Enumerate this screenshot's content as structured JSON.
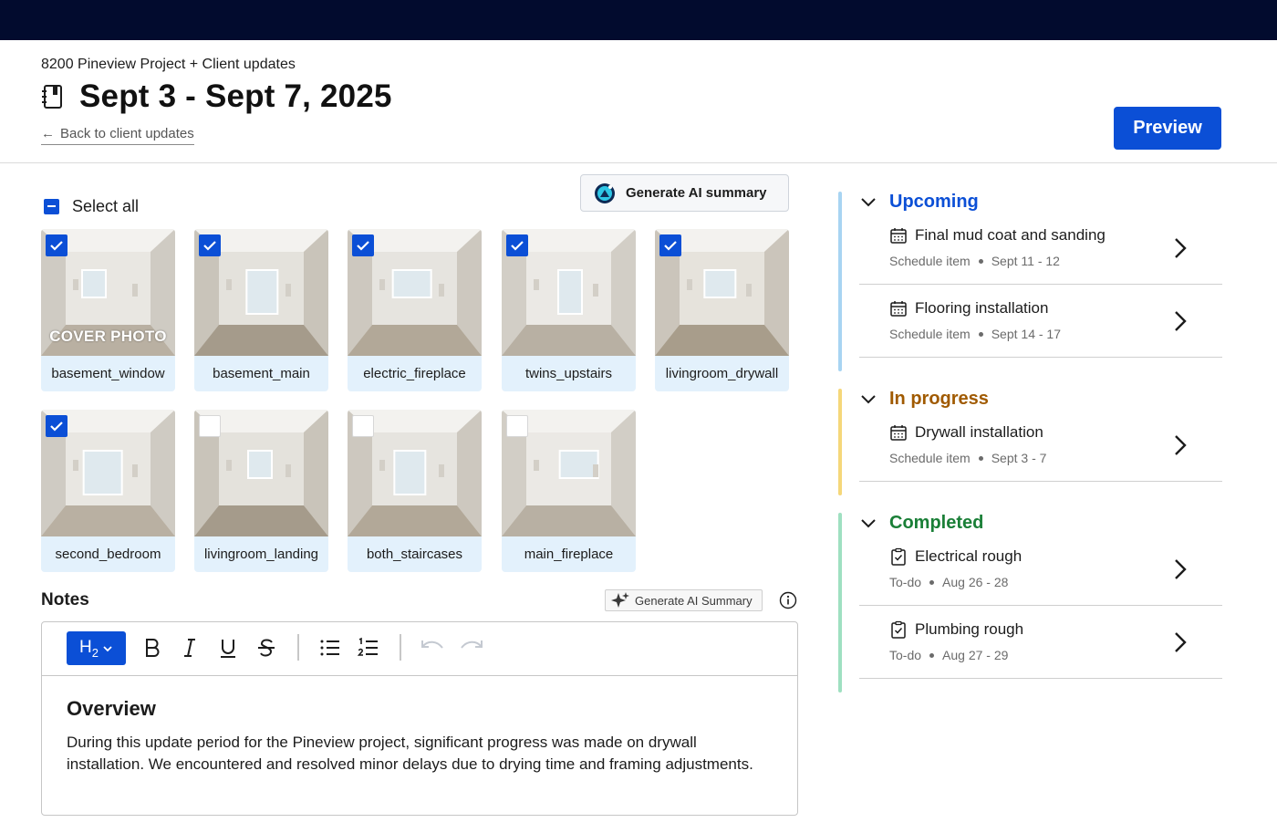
{
  "header": {
    "project_title": "8200 Pineview Project + Client updates",
    "page_title": "Sept 3 - Sept 7, 2025",
    "back_link": "Back to client updates",
    "preview_label": "Preview"
  },
  "gallery": {
    "select_all_label": "Select all",
    "generate_ai_label": "Generate AI summary",
    "cover_label": "COVER PHOTO",
    "photos": [
      {
        "name": "basement_window",
        "checked": true,
        "cover": true
      },
      {
        "name": "basement_main",
        "checked": true
      },
      {
        "name": "electric_fireplace",
        "checked": true
      },
      {
        "name": "twins_upstairs",
        "checked": true
      },
      {
        "name": "livingroom_drywall",
        "checked": true
      },
      {
        "name": "second_bedroom",
        "checked": true
      },
      {
        "name": "livingroom_landing",
        "checked": false
      },
      {
        "name": "both_staircases",
        "checked": false
      },
      {
        "name": "main_fireplace",
        "checked": false
      }
    ]
  },
  "notes": {
    "label": "Notes",
    "generate_ai_label": "Generate AI Summary",
    "toolbar": {
      "heading_label": "H2"
    },
    "heading": "Overview",
    "body": "During this update period for the Pineview project, significant progress was made on drywall installation. We encountered and resolved minor delays due to drying time and framing adjustments."
  },
  "schedule": {
    "groups": [
      {
        "title": "Upcoming",
        "color": "#0b4fd6",
        "bar_color": "#a8d4f2",
        "items": [
          {
            "name": "Final mud coat and sanding",
            "type": "Schedule item",
            "dates": "Sept 11 - 12",
            "icon": "calendar-icon"
          },
          {
            "name": "Flooring installation",
            "type": "Schedule item",
            "dates": "Sept 14 - 17",
            "icon": "calendar-icon"
          }
        ]
      },
      {
        "title": "In progress",
        "color": "#a05a00",
        "bar_color": "#f5d77a",
        "items": [
          {
            "name": "Drywall installation",
            "type": "Schedule item",
            "dates": "Sept 3 - 7",
            "icon": "calendar-icon"
          }
        ]
      },
      {
        "title": "Completed",
        "color": "#1a7f37",
        "bar_color": "#9fe0c1",
        "items": [
          {
            "name": "Electrical rough",
            "type": "To-do",
            "dates": "Aug 26 - 28",
            "icon": "clipboard-check-icon"
          },
          {
            "name": "Plumbing rough",
            "type": "To-do",
            "dates": "Aug 27 - 29",
            "icon": "clipboard-check-icon"
          }
        ]
      }
    ]
  }
}
